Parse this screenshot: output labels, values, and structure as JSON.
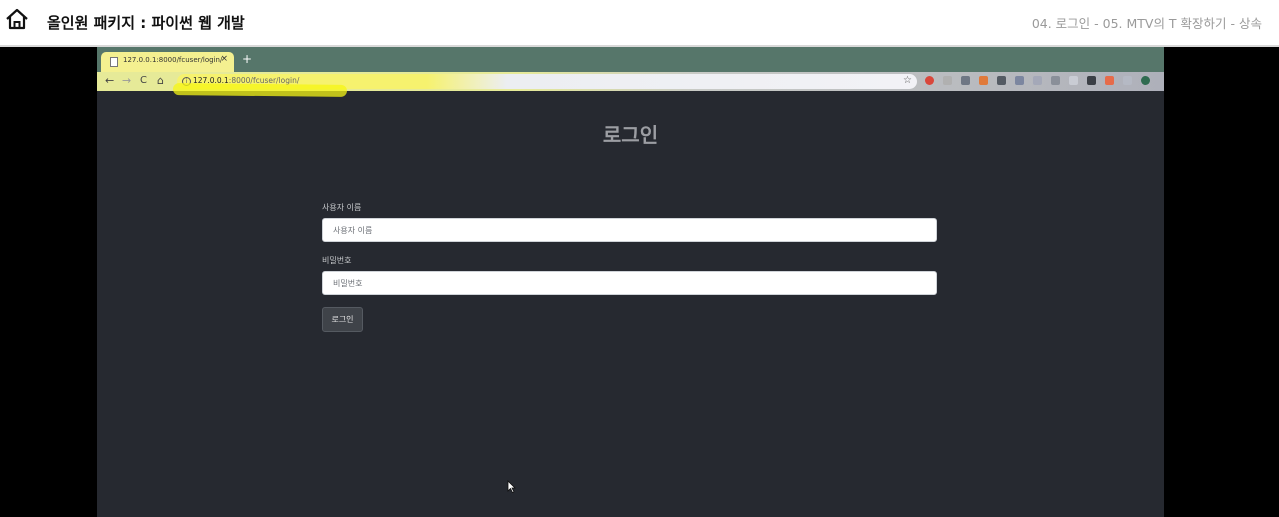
{
  "header": {
    "course_title": "올인원 패키지 : 파이썬 웹 개발",
    "lecture_title": "04. 로그인 - 05. MTV의 T 확장하기 - 상속"
  },
  "browser": {
    "tab_title": "127.0.0.1:8000/fcuser/login/",
    "tab_close": "×",
    "new_tab": "+",
    "url_host": "127.0.0.1",
    "url_path": ":8000/fcuser/login/",
    "nav": {
      "back": "←",
      "forward": "→",
      "reload": "C",
      "home": "⌂"
    },
    "star": "☆",
    "extension_colors": [
      "#d9473b",
      "#b0b0b0",
      "#6f7784",
      "#e07a3a",
      "#545a63",
      "#7c86a0",
      "#a4a8b8",
      "#8a8f99",
      "#c9ccd4",
      "#3b3f46",
      "#e66b4a",
      "#b5b9c4",
      "#2f6b50"
    ]
  },
  "page": {
    "heading": "로그인",
    "username_label": "사용자 이름",
    "username_placeholder": "사용자 이름",
    "password_label": "비밀번호",
    "password_placeholder": "비밀번호",
    "submit_label": "로그인"
  },
  "colors": {
    "page_background": "#262930",
    "tab_strip": "#56766a",
    "highlight": "#f5f514"
  }
}
